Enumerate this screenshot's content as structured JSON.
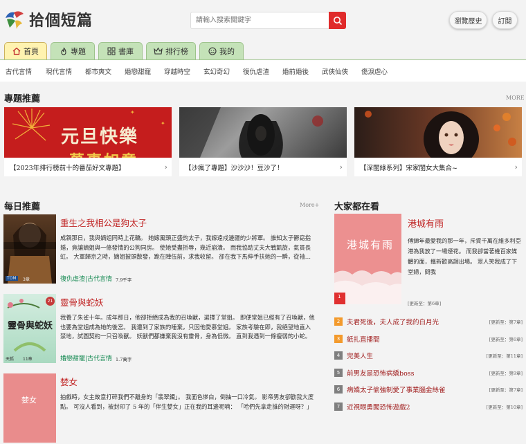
{
  "header": {
    "logo_text": "拾個短篇",
    "search_placeholder": "請輸入搜索關鍵字",
    "history_label": "瀏覽歷史",
    "subscribe_label": "訂閱"
  },
  "tabs": [
    {
      "label": "首頁",
      "icon": "home-icon",
      "active": true
    },
    {
      "label": "專題",
      "icon": "flame-icon",
      "active": false
    },
    {
      "label": "書庫",
      "icon": "grid-icon",
      "active": false
    },
    {
      "label": "排行榜",
      "icon": "crown-icon",
      "active": false
    },
    {
      "label": "我的",
      "icon": "smile-icon",
      "active": false
    }
  ],
  "categories": [
    "古代言情",
    "現代言情",
    "都市爽文",
    "婚戀甜寵",
    "穿越時空",
    "玄幻奇幻",
    "復仇虐渣",
    "婚前婚後",
    "武俠仙俠",
    "傷淚虐心"
  ],
  "featured": {
    "title": "專題推薦",
    "more": "MORE",
    "items": [
      {
        "caption": "【2023年排行榜前十的番茄好文專題】",
        "image_text": "元旦快樂",
        "image_text2": "萬事如意"
      },
      {
        "caption": "【沙瘋了專題】沙沙沙！豆沙了！"
      },
      {
        "caption": "【深閨綠系列】宋家閨女大集合~"
      }
    ]
  },
  "daily": {
    "title": "每日推薦",
    "more": "More+",
    "books": [
      {
        "title": "重生之我相公是狗太子",
        "desc": "成親那日，我與嫡姐同時上花轎。 她嫁風頭正盛的太子，我嫁遠戍邊疆的少將軍。 誰知太子鬱窈指婚，竟讓嫡姐與一條發情的公狗同房。 使她受盡折辱，幾近崩潰。 而我協助丈夫大戰凱旋，氣貫長虹。 大軍歸京之時，嫡姐披頭散發，跪在陣伍前，求我收留。 卻在我下馬伸手扶她的一瞬，從袖…",
        "category": "復仇虐渣|古代言情",
        "count": "7.9千字",
        "badge_left": "TOM",
        "badge_right": "3章"
      },
      {
        "title": "靈骨與蛇妖",
        "desc": "我養了朱雀十年。成年那日，他卻拒絕成為我的召喚獸，選擇了堂姐。 即便堂姐已經有了召喚獸，他也要為堂姐成為她的後宮。 我遭到了家族的唾棄，只因他愛慕堂姐。 家族考驗在即，我絕望地直入禁地，試圖契約一只召喚獸。 妖獸們都嫌棄我沒有靈骨，身為低微。 直到我遇到一條瘦弱的小蛇。 他哀…",
        "category": "婚戀甜寵|古代言情",
        "count": "1.7萬字",
        "badge_left": "天狐",
        "badge_right": "11章",
        "cover_text": "靈骨與蛇妖",
        "cover_num": "21"
      },
      {
        "title": "婪女",
        "desc": "拍戲時，女主故意打碎我們不離身的「翡翠鐲」。 我面色慘白，倒抽一口冷氣。 影帝男友卻勸我大度點。 可沒人看到，被封印了 5 年的「伴生婪女」正在我的耳邊呢喃： 「哈們先拿走誰的財運呀？」",
        "cover_text": "婪女"
      }
    ]
  },
  "ranking": {
    "title": "大家都在看",
    "top": {
      "title": "港城有雨",
      "desc": "傅錦年最愛我的那一年，斥資千萬在維多利亞港為我放了一場煙花。 而我卻當著幾百家媒體的面，攜新歡高調出場。 眾人笑我成了下堂婦，問我",
      "update": "[更新至：第6章]",
      "rank": "1",
      "cover_text": "港城有雨"
    },
    "items": [
      {
        "rank": "2",
        "title": "夫君死後，夫人成了我的白月光",
        "update": "[更新至：第7章]",
        "color": "#f39a2c"
      },
      {
        "rank": "3",
        "title": "紙扎直播間",
        "update": "[更新至：第6章]",
        "color": "#f39a2c"
      },
      {
        "rank": "4",
        "title": "完美人生",
        "update": "[更新至：第11章]",
        "color": "#7f7f7f"
      },
      {
        "rank": "5",
        "title": "前男友是恐怖病嬌boss",
        "update": "[更新至：第9章]",
        "color": "#7f7f7f"
      },
      {
        "rank": "6",
        "title": "病嬌太子偷強制愛了事業腦金絲雀",
        "update": "[更新至：第7章]",
        "color": "#7f7f7f"
      },
      {
        "rank": "7",
        "title": "近視眼勇闖恐怖遊戲2",
        "update": "[更新至：第10章]",
        "color": "#7f7f7f"
      }
    ]
  },
  "colors": {
    "accent_red": "#e02b2b",
    "title_red": "#c02323",
    "tab_green": "#c4e2b8",
    "tab_active": "#fff3b0",
    "category_green": "#158a52",
    "rank_red": "#e03030"
  }
}
